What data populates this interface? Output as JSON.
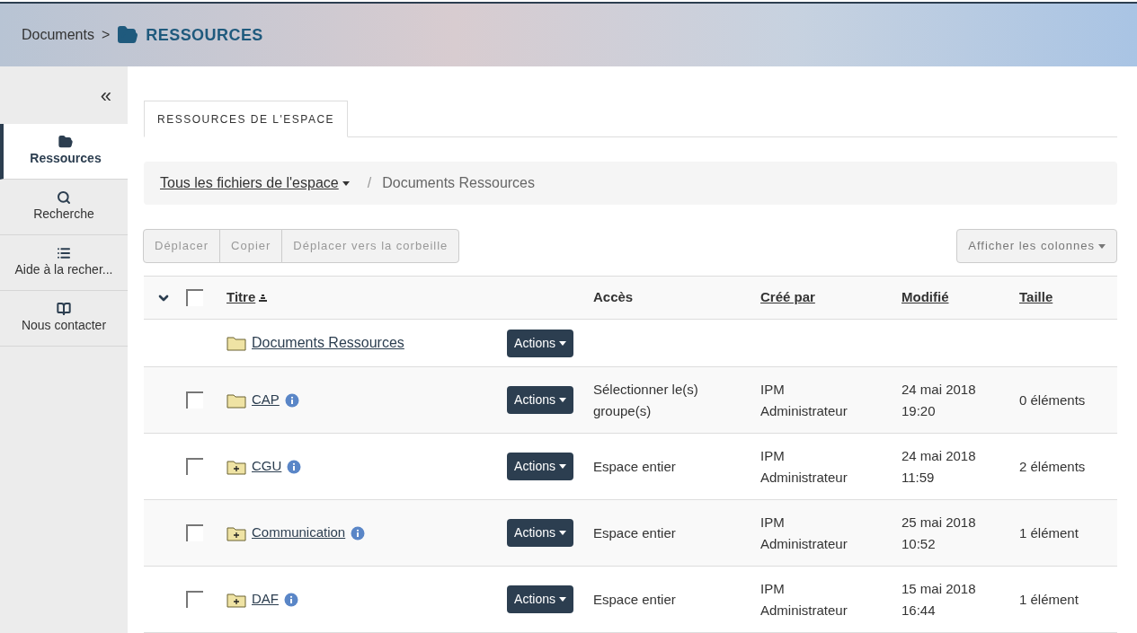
{
  "header": {
    "breadcrumb_root": "Documents",
    "separator": ">",
    "title": "RESSOURCES"
  },
  "sidebar": {
    "collapse": "«",
    "items": [
      {
        "kind": "folder",
        "label": "Ressources",
        "selected": true
      },
      {
        "kind": "search",
        "label": "Recherche",
        "selected": false
      },
      {
        "kind": "list",
        "label": "Aide à la recher...",
        "selected": false
      },
      {
        "kind": "book",
        "label": "Nous contacter",
        "selected": false
      }
    ]
  },
  "tabs": [
    {
      "label": "RESSOURCES DE L'ESPACE",
      "selected": true
    }
  ],
  "path": {
    "root": "Tous les fichiers de l'espace",
    "separator": "/",
    "current": "Documents Ressources"
  },
  "toolbar": {
    "buttons": [
      {
        "label": "Déplacer",
        "disabled": true
      },
      {
        "label": "Copier",
        "disabled": true
      },
      {
        "label": "Déplacer vers la corbeille",
        "disabled": true
      }
    ],
    "columns_button": "Afficher les colonnes"
  },
  "table": {
    "select_all": {
      "checked": false
    },
    "columns": [
      "Titre",
      "Accès",
      "Créé par",
      "Modifié",
      "Taille"
    ],
    "parent": {
      "title": "Documents Ressources",
      "action": "Actions"
    },
    "rows": [
      {
        "kind": "empty",
        "title": "CAP",
        "action": "Actions",
        "access": "Sélectionner le(s) groupe(s)",
        "creator": "IPM Administrateur",
        "modified": "24 mai 2018 19:20",
        "size": "0 éléments",
        "checked": false
      },
      {
        "kind": "plus",
        "title": "CGU",
        "action": "Actions",
        "access": "Espace entier",
        "creator": "IPM Administrateur",
        "modified": "24 mai 2018 11:59",
        "size": "2 éléments",
        "checked": false
      },
      {
        "kind": "plus",
        "title": "Communication",
        "action": "Actions",
        "access": "Espace entier",
        "creator": "IPM Administrateur",
        "modified": "25 mai 2018 10:52",
        "size": "1 élément",
        "checked": false
      },
      {
        "kind": "plus",
        "title": "DAF",
        "action": "Actions",
        "access": "Espace entier",
        "creator": "IPM Administrateur",
        "modified": "15 mai 2018 16:44",
        "size": "1 élément",
        "checked": false
      }
    ]
  }
}
